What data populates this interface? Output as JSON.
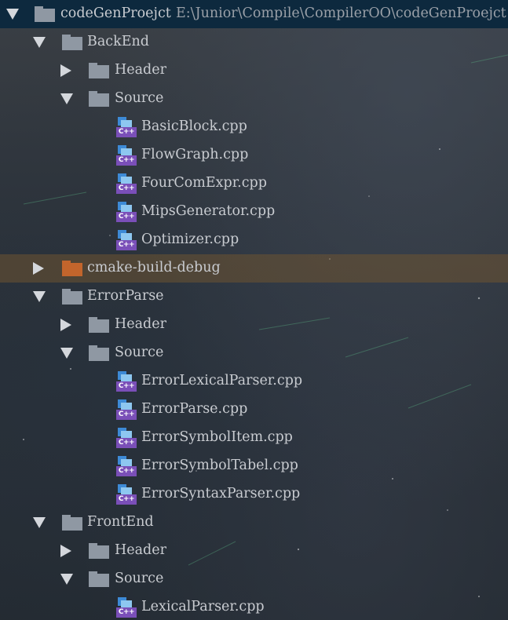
{
  "project": {
    "name": "codeGenProejct",
    "path": "E:\\Junior\\Compile\\CompilerOO\\codeGenProejct"
  },
  "tree": {
    "backend": {
      "label": "BackEnd",
      "header": "Header",
      "source": "Source",
      "files": [
        "BasicBlock.cpp",
        "FlowGraph.cpp",
        "FourComExpr.cpp",
        "MipsGenerator.cpp",
        "Optimizer.cpp"
      ]
    },
    "cmake": {
      "label": "cmake-build-debug"
    },
    "errorparse": {
      "label": "ErrorParse",
      "header": "Header",
      "source": "Source",
      "files": [
        "ErrorLexicalParser.cpp",
        "ErrorParse.cpp",
        "ErrorSymbolItem.cpp",
        "ErrorSymbolTabel.cpp",
        "ErrorSyntaxParser.cpp"
      ]
    },
    "frontend": {
      "label": "FrontEnd",
      "header": "Header",
      "source": "Source",
      "files": [
        "LexicalParser.cpp"
      ]
    }
  },
  "icons": {
    "cpp_badge": "C++",
    "folder": "folder-icon",
    "excluded_folder": "excluded-folder-icon",
    "cpp_file": "cpp-file-icon"
  },
  "colors": {
    "selection": "#0d293e",
    "highlight": "#6e5432",
    "folder": "#8f98a3",
    "excluded_folder": "#c2652c",
    "cpp_badge": "#7a4fb8",
    "cpp_blue": "#3d8ad6"
  }
}
